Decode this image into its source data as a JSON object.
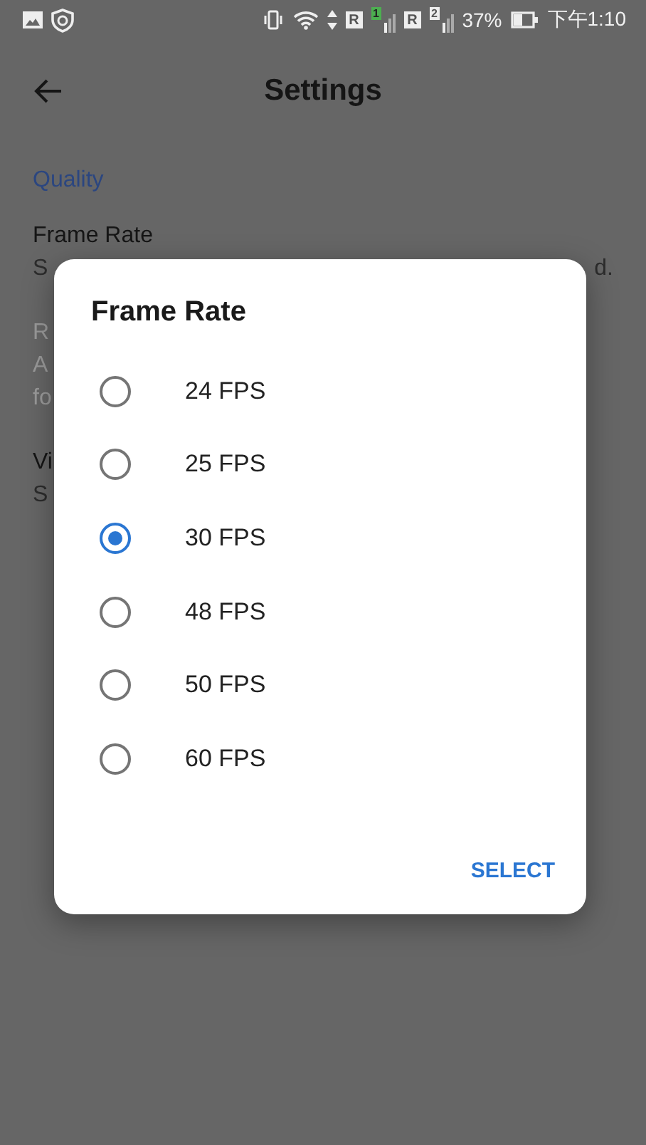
{
  "status_bar": {
    "sims": [
      {
        "roaming": "R",
        "slot": "1",
        "active": true
      },
      {
        "roaming": "R",
        "slot": "2",
        "active": false
      }
    ],
    "battery": "37%",
    "time": "下午1:10"
  },
  "app_bar": {
    "title": "Settings"
  },
  "settings": {
    "section": "Quality",
    "items": [
      {
        "title": "Frame Rate",
        "summary": [
          {
            "left": "S",
            "right": "d."
          }
        ],
        "disabled": false
      },
      {
        "title": "R",
        "summary": [
          {
            "left": "A"
          },
          {
            "left": "fo"
          }
        ],
        "disabled": true
      },
      {
        "title": "Vi",
        "summary": [
          {
            "left": "S"
          }
        ],
        "disabled": false
      }
    ]
  },
  "dialog": {
    "title": "Frame Rate",
    "options": [
      {
        "label": "24 FPS",
        "selected": false
      },
      {
        "label": "25 FPS",
        "selected": false
      },
      {
        "label": "30 FPS",
        "selected": true
      },
      {
        "label": "48 FPS",
        "selected": false
      },
      {
        "label": "50 FPS",
        "selected": false
      },
      {
        "label": "60 FPS",
        "selected": false
      }
    ],
    "button": "SELECT"
  }
}
